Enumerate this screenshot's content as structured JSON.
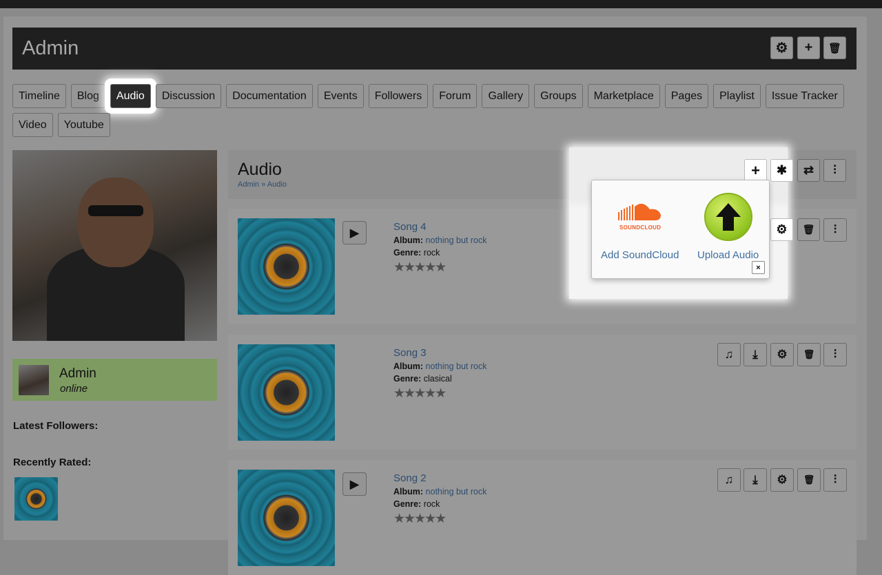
{
  "header": {
    "title": "Admin",
    "buttons": [
      "gear-icon",
      "plus-icon",
      "trash-icon"
    ]
  },
  "tabs": [
    "Timeline",
    "Blog",
    "Audio",
    "Discussion",
    "Documentation",
    "Events",
    "Followers",
    "Forum",
    "Gallery",
    "Groups",
    "Marketplace",
    "Pages",
    "Playlist",
    "Issue Tracker",
    "Video",
    "Youtube"
  ],
  "active_tab": "Audio",
  "user": {
    "name": "Admin",
    "status": "online"
  },
  "sidebar": {
    "latest_followers": "Latest Followers:",
    "recently_rated": "Recently Rated:"
  },
  "main": {
    "title": "Audio",
    "breadcrumb": "Admin » Audio"
  },
  "songs": [
    {
      "title": "Song 4",
      "album_label": "Album:",
      "album": "nothing but rock",
      "genre_label": "Genre:",
      "genre": "rock",
      "stars": "★★★★★"
    },
    {
      "title": "Song 3",
      "album_label": "Album:",
      "album": "nothing but rock",
      "genre_label": "Genre:",
      "genre": "clasical",
      "stars": "★★★★★"
    },
    {
      "title": "Song 2",
      "album_label": "Album:",
      "album": "nothing but rock",
      "genre_label": "Genre:",
      "genre": "rock",
      "stars": "★★★★★"
    }
  ],
  "popup": {
    "soundcloud_label": "Add SoundCloud",
    "soundcloud_logo_text": "SOUNDCLOUD",
    "upload_label": "Upload Audio",
    "close": "×"
  },
  "icons": {
    "play": "▶",
    "plus": "+",
    "asterisk": "✱",
    "refresh": "⇄",
    "sliders": "⫶",
    "gear": "⚙",
    "trash": "🗑",
    "music": "♫",
    "download": "⤓"
  }
}
